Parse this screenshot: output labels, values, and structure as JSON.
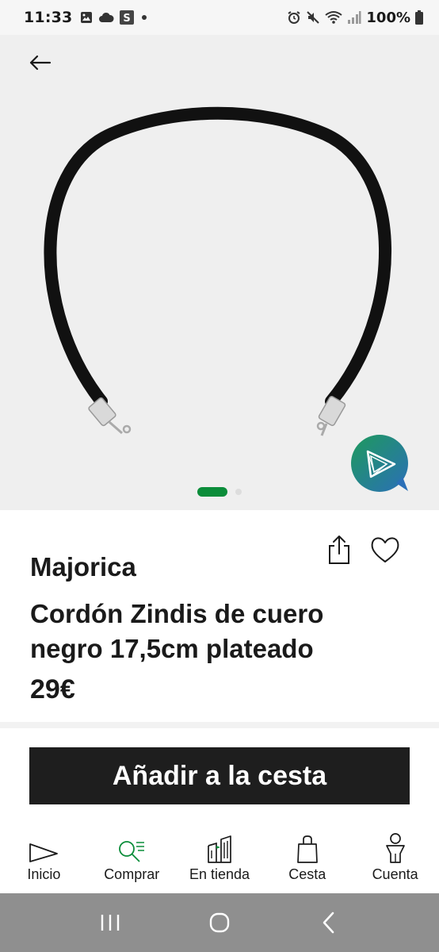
{
  "status_bar": {
    "time": "11:33",
    "battery": "100%",
    "left_icons": [
      "gallery-icon",
      "cloud-icon",
      "s-app-icon",
      "dot-icon"
    ],
    "right_icons": [
      "alarm-icon",
      "mute-icon",
      "wifi-icon",
      "signal-icon",
      "battery-icon"
    ]
  },
  "gallery": {
    "back_icon": "arrow-left-icon",
    "image_alt": "black-leather-cord-necklace",
    "slide_count": 2,
    "active_slide": 1
  },
  "product": {
    "brand": "Majorica",
    "title": "Cordón Zindis de cuero negro 17,5cm plateado",
    "price": "29€"
  },
  "actions": {
    "add_to_cart": "Añadir a la cesta"
  },
  "bottom_nav": {
    "items": [
      {
        "label": "Inicio",
        "icon": "home-flag-icon"
      },
      {
        "label": "Comprar",
        "icon": "search-list-icon"
      },
      {
        "label": "En tienda",
        "icon": "store-building-icon"
      },
      {
        "label": "Cesta",
        "icon": "shopping-bag-icon"
      },
      {
        "label": "Cuenta",
        "icon": "user-icon"
      }
    ]
  },
  "colors": {
    "accent_green": "#0b8d3a",
    "button_dark": "#1e1e1e",
    "gallery_bg": "#efefef",
    "system_nav_bg": "#8f8f8f"
  }
}
